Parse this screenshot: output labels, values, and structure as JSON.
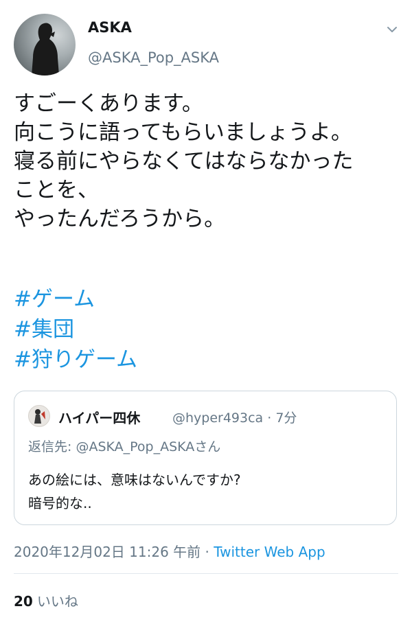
{
  "tweet": {
    "author": {
      "display_name": "ASKA",
      "handle": "@ASKA_Pop_ASKA"
    },
    "body_lines": [
      "すごーくあります。",
      "向こうに語ってもらいましょうよ。",
      "寝る前にやらなくてはならなかった",
      "ことを、",
      "やったんだろうから。"
    ],
    "hashtags": [
      "#ゲーム",
      "#集団",
      "#狩りゲーム"
    ],
    "quoted": {
      "display_name": "ハイパー四休",
      "handle_time": "@hyper493ca · 7分",
      "reply_to": "返信先: @ASKA_Pop_ASKAさん",
      "text_lines": [
        "あの絵には、意味はないんですか?",
        "暗号的な.."
      ]
    },
    "timestamp": "2020年12月02日 11:26 午前 · ",
    "source": "Twitter Web App",
    "likes_count": "20",
    "likes_label": "いいね"
  },
  "icons": {
    "menu": "chevron-down-icon",
    "avatar": "avatar-silhouette"
  },
  "colors": {
    "hashtag": "#1b95e0",
    "secondary_text": "#657786",
    "primary_text": "#14171a",
    "border": "#ccd6dd"
  }
}
